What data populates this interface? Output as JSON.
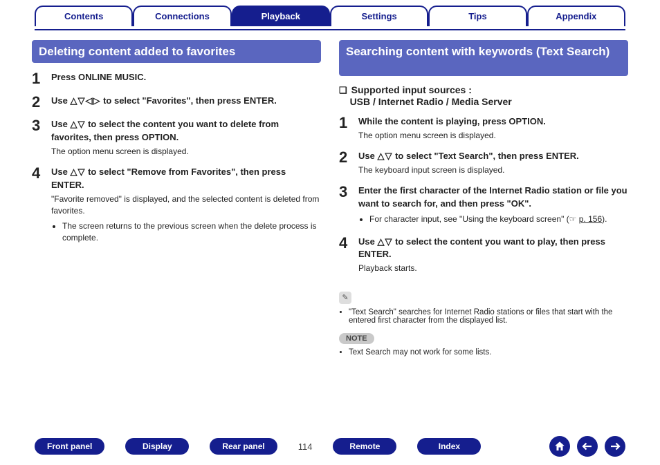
{
  "tabs": [
    "Contents",
    "Connections",
    "Playback",
    "Settings",
    "Tips",
    "Appendix"
  ],
  "active_tab_index": 2,
  "left": {
    "heading": "Deleting content added to favorites",
    "steps": [
      {
        "num": "1",
        "bold": "Press ONLINE MUSIC."
      },
      {
        "num": "2",
        "bold_pre": "Use ",
        "arrows": "△▽◁▷",
        "bold_post": " to select \"Favorites\", then press ENTER."
      },
      {
        "num": "3",
        "bold_pre": "Use ",
        "arrows": "△▽",
        "bold_post": " to select the content you want to delete from favorites, then press OPTION.",
        "sub": "The option menu screen is displayed."
      },
      {
        "num": "4",
        "bold_pre": "Use ",
        "arrows": "△▽",
        "bold_post": " to select \"Remove from Favorites\", then press ENTER.",
        "sub": "\"Favorite removed\" is displayed, and the selected content is deleted from favorites.",
        "bullets": [
          "The screen returns to the previous screen when the delete process is complete."
        ]
      }
    ]
  },
  "right": {
    "heading": "Searching content with keywords (Text Search)",
    "supported_label": "Supported input sources :",
    "supported_value": "USB / Internet Radio / Media Server",
    "steps": [
      {
        "num": "1",
        "bold": "While the content is playing, press OPTION.",
        "sub": "The option menu screen is displayed."
      },
      {
        "num": "2",
        "bold_pre": "Use ",
        "arrows": "△▽",
        "bold_post": " to select \"Text Search\", then press ENTER.",
        "sub": "The keyboard input screen is displayed."
      },
      {
        "num": "3",
        "bold": "Enter the first character of the Internet Radio station or file you want to search for, and then press \"OK\".",
        "bullets_html": {
          "text": "For character input, see \"Using the keyboard screen\" (☞ ",
          "link": "p. 156",
          "after": ")."
        }
      },
      {
        "num": "4",
        "bold_pre": "Use ",
        "arrows": "△▽",
        "bold_post": " to select the content you want to play, then press ENTER.",
        "sub": "Playback starts."
      }
    ],
    "info_bullets": [
      "\"Text Search\" searches for Internet Radio stations or files that start with the entered first character from the displayed list."
    ],
    "note_label": "NOTE",
    "note_bullets": [
      "Text Search may not work for some lists."
    ]
  },
  "footer": {
    "buttons": [
      "Front panel",
      "Display",
      "Rear panel"
    ],
    "page": "114",
    "buttons2": [
      "Remote",
      "Index"
    ]
  }
}
